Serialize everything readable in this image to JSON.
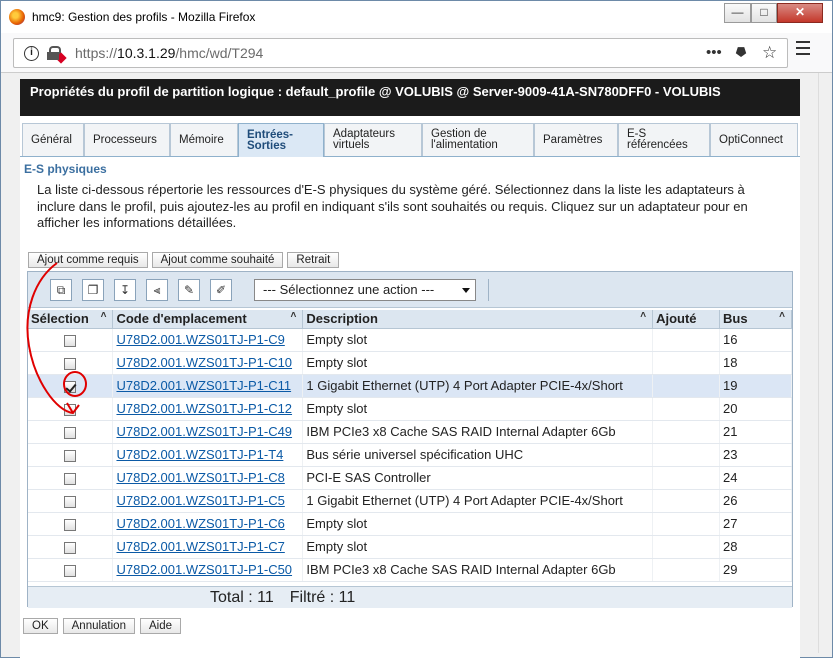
{
  "window": {
    "title": "hmc9: Gestion des profils - Mozilla Firefox",
    "min_label": "—",
    "max_label": "□",
    "close_label": "✕"
  },
  "urlbar": {
    "host": "10.3.1.29",
    "path": "/hmc/wd/T294",
    "scheme": "https://",
    "more_label": "•••",
    "star_label": "☆"
  },
  "banner": {
    "text": "Propriétés du profil de partition logique : default_profile @ VOLUBIS @ Server-9009-41A-SN780DFF0 - VOLUBIS"
  },
  "tabs": [
    {
      "label": "Général"
    },
    {
      "label": "Processeurs"
    },
    {
      "label": "Mémoire"
    },
    {
      "label": "Entrées-Sorties"
    },
    {
      "label": "Adaptateurs virtuels"
    },
    {
      "label": "Gestion de l'alimentation"
    },
    {
      "label": "Paramètres"
    },
    {
      "label": "E-S référencées"
    },
    {
      "label": "OptiConnect"
    }
  ],
  "section": {
    "title": "E-S physiques",
    "intro": "La liste ci-dessous répertorie les ressources d'E-S physiques du système géré. Sélectionnez dans la liste les adaptateurs à inclure dans le profil, puis ajoutez-les au profil en indiquant s'ils sont souhaités ou requis. Cliquez sur un adaptateur pour en afficher les informations détaillées."
  },
  "actions": {
    "add_required": "Ajout comme requis",
    "add_desired": "Ajout comme souhaité",
    "remove": "Retrait"
  },
  "toolbar": {
    "select_action": "--- Sélectionnez une action ---"
  },
  "table": {
    "headers": {
      "selection": "Sélection",
      "location": "Code d'emplacement",
      "description": "Description",
      "added": "Ajouté",
      "bus": "Bus"
    },
    "rows": [
      {
        "location": "U78D2.001.WZS01TJ-P1-C9",
        "description": "Empty slot",
        "added": "",
        "bus": "16",
        "checked": false
      },
      {
        "location": "U78D2.001.WZS01TJ-P1-C10",
        "description": "Empty slot",
        "added": "",
        "bus": "18",
        "checked": false
      },
      {
        "location": "U78D2.001.WZS01TJ-P1-C11",
        "description": "1 Gigabit Ethernet (UTP) 4 Port Adapter PCIE-4x/Short",
        "added": "",
        "bus": "19",
        "checked": true
      },
      {
        "location": "U78D2.001.WZS01TJ-P1-C12",
        "description": "Empty slot",
        "added": "",
        "bus": "20",
        "checked": false
      },
      {
        "location": "U78D2.001.WZS01TJ-P1-C49",
        "description": "IBM PCIe3 x8 Cache SAS RAID Internal Adapter 6Gb",
        "added": "",
        "bus": "21",
        "checked": false
      },
      {
        "location": "U78D2.001.WZS01TJ-P1-T4",
        "description": "Bus série universel spécification UHC",
        "added": "",
        "bus": "23",
        "checked": false
      },
      {
        "location": "U78D2.001.WZS01TJ-P1-C8",
        "description": "PCI-E SAS Controller",
        "added": "",
        "bus": "24",
        "checked": false
      },
      {
        "location": "U78D2.001.WZS01TJ-P1-C5",
        "description": "1 Gigabit Ethernet (UTP) 4 Port Adapter PCIE-4x/Short",
        "added": "",
        "bus": "26",
        "checked": false
      },
      {
        "location": "U78D2.001.WZS01TJ-P1-C6",
        "description": "Empty slot",
        "added": "",
        "bus": "27",
        "checked": false
      },
      {
        "location": "U78D2.001.WZS01TJ-P1-C7",
        "description": "Empty slot",
        "added": "",
        "bus": "28",
        "checked": false
      },
      {
        "location": "U78D2.001.WZS01TJ-P1-C50",
        "description": "IBM PCIe3 x8 Cache SAS RAID Internal Adapter 6Gb",
        "added": "",
        "bus": "29",
        "checked": false
      }
    ],
    "total": "Total : 11",
    "filtered": "Filtré : 11"
  },
  "buttons": {
    "ok": "OK",
    "cancel": "Annulation",
    "help": "Aide"
  },
  "colors": {
    "annotation": "#e00000",
    "banner": "#1b1b1b",
    "link": "#0b5aa6"
  }
}
